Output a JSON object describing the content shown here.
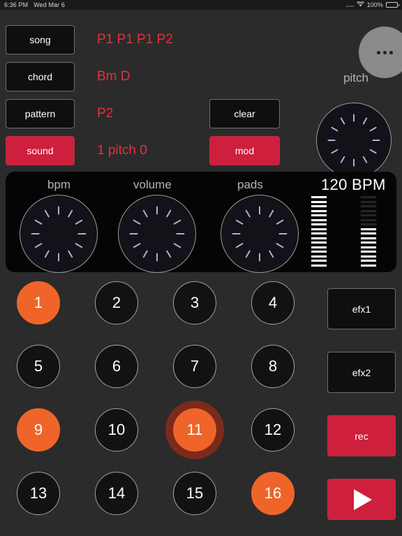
{
  "status_bar": {
    "time": "6:36 PM",
    "date": "Wed Mar 6",
    "battery_percent": "100%",
    "wifi_icon": "wifi-icon",
    "battery_icon": "battery-icon"
  },
  "top_controls": {
    "mode_buttons": [
      {
        "label": "song",
        "active": false
      },
      {
        "label": "chord",
        "active": false
      },
      {
        "label": "pattern",
        "active": false
      },
      {
        "label": "sound",
        "active": true
      }
    ],
    "readouts": [
      "P1 P1 P1 P2",
      "Bm D",
      "P2",
      "1 pitch 0"
    ],
    "action_buttons": [
      {
        "label": "clear",
        "active": false
      },
      {
        "label": "mod",
        "active": true
      }
    ],
    "overflow_icon": "more-options-icon",
    "pitch_label": "pitch"
  },
  "panel": {
    "knobs": [
      {
        "label": "bpm"
      },
      {
        "label": "volume"
      },
      {
        "label": "pads"
      }
    ],
    "bpm_readout": "120 BPM",
    "meters": [
      {
        "name": "meter-left",
        "segments": 16,
        "lit": 16
      },
      {
        "name": "meter-right",
        "segments": 16,
        "lit": 9
      }
    ]
  },
  "pads": [
    {
      "label": "1",
      "state": "on"
    },
    {
      "label": "2",
      "state": "off"
    },
    {
      "label": "3",
      "state": "off"
    },
    {
      "label": "4",
      "state": "off"
    },
    {
      "label": "5",
      "state": "off"
    },
    {
      "label": "6",
      "state": "off"
    },
    {
      "label": "7",
      "state": "off"
    },
    {
      "label": "8",
      "state": "off"
    },
    {
      "label": "9",
      "state": "on"
    },
    {
      "label": "10",
      "state": "off"
    },
    {
      "label": "11",
      "state": "glow"
    },
    {
      "label": "12",
      "state": "off"
    },
    {
      "label": "13",
      "state": "off"
    },
    {
      "label": "14",
      "state": "off"
    },
    {
      "label": "15",
      "state": "off"
    },
    {
      "label": "16",
      "state": "on"
    }
  ],
  "side_buttons": [
    {
      "label": "efx1",
      "active": false,
      "icon": null
    },
    {
      "label": "efx2",
      "active": false,
      "icon": null
    },
    {
      "label": "rec",
      "active": true,
      "icon": null
    },
    {
      "label": "",
      "active": true,
      "icon": "play-icon"
    }
  ],
  "colors": {
    "accent_orange": "#ef6529",
    "accent_red": "#ce1f3c",
    "label_red": "#e2313f",
    "tick_blue": "#a9b2d6",
    "page_bg": "#2b2b2b",
    "panel_bg": "#050505"
  }
}
